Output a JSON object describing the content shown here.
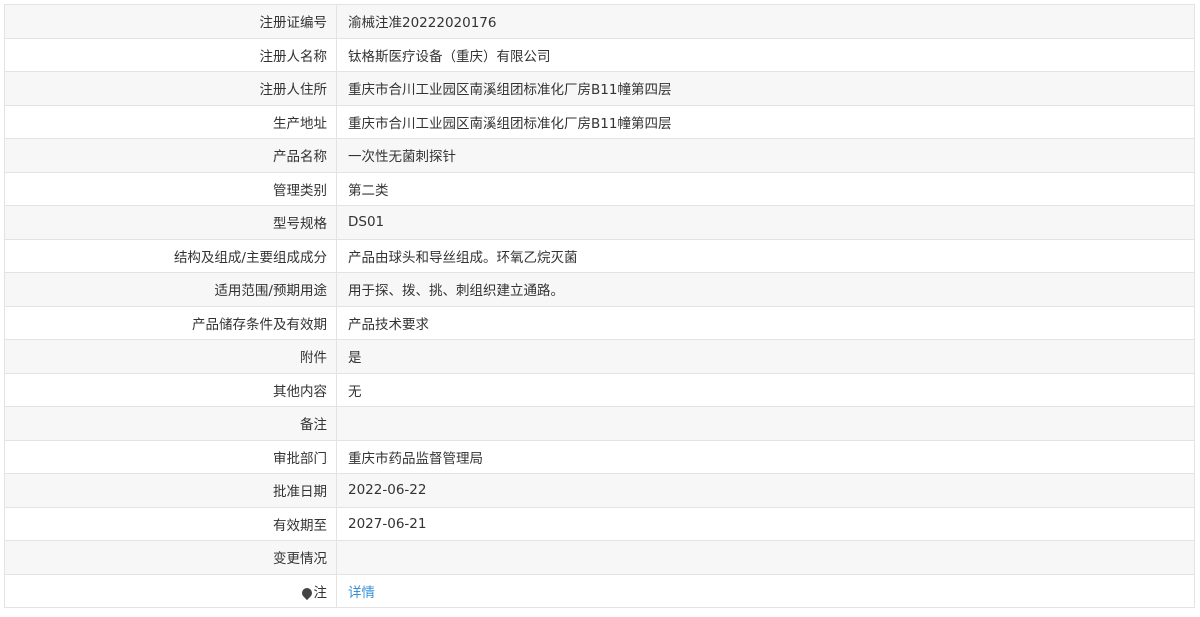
{
  "rows": [
    {
      "label": "注册证编号",
      "value": "渝械注准20222020176"
    },
    {
      "label": "注册人名称",
      "value": "钛格斯医疗设备（重庆）有限公司"
    },
    {
      "label": "注册人住所",
      "value": "重庆市合川工业园区南溪组团标准化厂房B11幢第四层"
    },
    {
      "label": "生产地址",
      "value": "重庆市合川工业园区南溪组团标准化厂房B11幢第四层"
    },
    {
      "label": "产品名称",
      "value": "一次性无菌刺探针"
    },
    {
      "label": "管理类别",
      "value": "第二类"
    },
    {
      "label": "型号规格",
      "value": "DS01"
    },
    {
      "label": "结构及组成/主要组成成分",
      "value": "产品由球头和导丝组成。环氧乙烷灭菌"
    },
    {
      "label": "适用范围/预期用途",
      "value": "用于探、拨、挑、刺组织建立通路。"
    },
    {
      "label": "产品储存条件及有效期",
      "value": "产品技术要求"
    },
    {
      "label": "附件",
      "value": "是"
    },
    {
      "label": "其他内容",
      "value": "无"
    },
    {
      "label": "备注",
      "value": ""
    },
    {
      "label": "审批部门",
      "value": "重庆市药品监督管理局"
    },
    {
      "label": "批准日期",
      "value": "2022-06-22"
    },
    {
      "label": "有效期至",
      "value": "2027-06-21"
    },
    {
      "label": "变更情况",
      "value": ""
    }
  ],
  "note_row": {
    "label": "注",
    "icon": "note-pin-icon",
    "link_text": "详情",
    "link_color": "#3a8fd6"
  }
}
